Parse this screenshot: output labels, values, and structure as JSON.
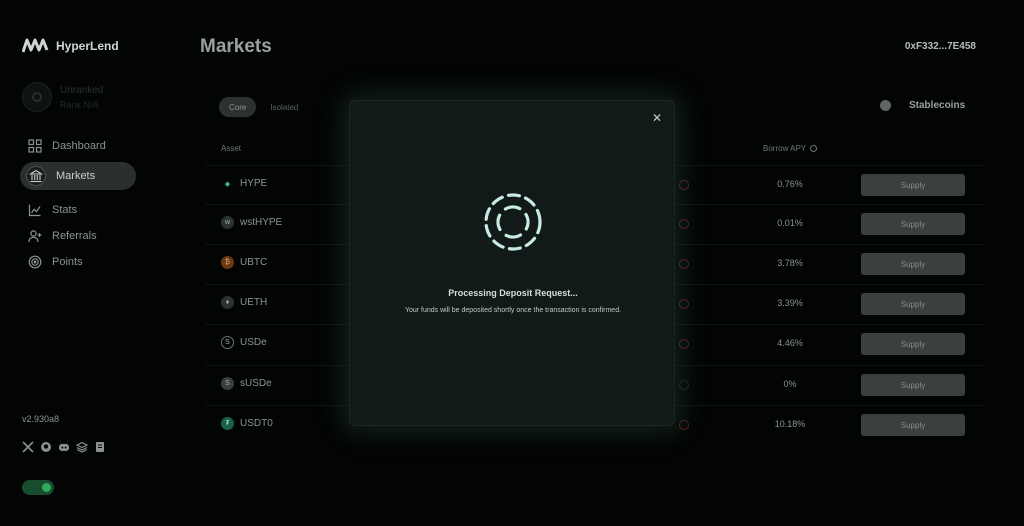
{
  "app": {
    "name": "HyperLend"
  },
  "account": {
    "line1": "Unranked",
    "line2": "Rank N/A"
  },
  "nav": {
    "items": [
      {
        "label": "Dashboard",
        "icon": "dashboard-icon"
      },
      {
        "label": "Markets",
        "icon": "bank-icon"
      },
      {
        "label": "Stats",
        "icon": "chart-icon"
      },
      {
        "label": "Referrals",
        "icon": "user-plus-icon"
      },
      {
        "label": "Points",
        "icon": "target-icon"
      }
    ]
  },
  "footer": {
    "version": "v2.930a8"
  },
  "page": {
    "title": "Markets",
    "wallet": "0xF332...7E458"
  },
  "tabs": {
    "core": "Core",
    "isolated": "Isolated"
  },
  "filter": {
    "stablecoins": "Stablecoins"
  },
  "table": {
    "headers": {
      "asset": "Asset",
      "borrow_apy": "Borrow APY"
    },
    "rows": [
      {
        "asset": "HYPE",
        "borrow_apy": "0.76%",
        "action": "Supply"
      },
      {
        "asset": "wstHYPE",
        "borrow_apy": "0.01%",
        "action": "Supply"
      },
      {
        "asset": "UBTC",
        "borrow_apy": "3.78%",
        "action": "Supply"
      },
      {
        "asset": "UETH",
        "borrow_apy": "3.39%",
        "action": "Supply"
      },
      {
        "asset": "USDe",
        "borrow_apy": "4.46%",
        "action": "Supply"
      },
      {
        "asset": "sUSDe",
        "borrow_apy": "0%",
        "action": "Supply"
      },
      {
        "asset": "USDT0",
        "borrow_apy": "10.18%",
        "action": "Supply"
      }
    ]
  },
  "modal": {
    "title": "Processing Deposit Request...",
    "message": "Your funds will be deposited shortly once the transaction is confirmed.",
    "close_icon": "close-icon"
  },
  "colors": {
    "accent": "#c9ebe3",
    "toggle_on": "#2ea860",
    "risk": "#5a1e18"
  }
}
